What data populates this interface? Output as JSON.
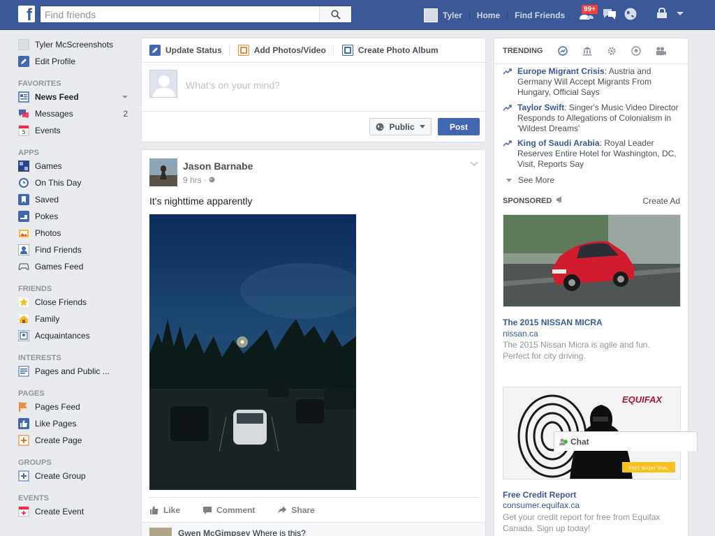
{
  "topbar": {
    "logo": "f",
    "search_placeholder": "Find friends",
    "user_name": "Tyler",
    "home": "Home",
    "find_friends": "Find Friends",
    "friend_requests_badge": "99+"
  },
  "leftnav": {
    "profile_name": "Tyler McScreenshots",
    "edit_profile": "Edit Profile",
    "favorites_head": "FAVORITES",
    "news_feed": "News Feed",
    "messages": "Messages",
    "messages_count": "2",
    "events": "Events",
    "apps_head": "APPS",
    "games": "Games",
    "on_this_day": "On This Day",
    "saved": "Saved",
    "pokes": "Pokes",
    "photos": "Photos",
    "find_friends": "Find Friends",
    "games_feed": "Games Feed",
    "friends_head": "FRIENDS",
    "close_friends": "Close Friends",
    "family": "Family",
    "acquaintances": "Acquaintances",
    "interests_head": "INTERESTS",
    "pages_public": "Pages and Public ...",
    "pages_head": "PAGES",
    "pages_feed": "Pages Feed",
    "like_pages": "Like Pages",
    "create_page": "Create Page",
    "groups_head": "GROUPS",
    "create_group": "Create Group",
    "events_head": "EVENTS",
    "create_event": "Create Event"
  },
  "composer": {
    "update_status": "Update Status",
    "add_photos": "Add Photos/Video",
    "create_album": "Create Photo Album",
    "placeholder": "What's on your mind?",
    "privacy": "Public",
    "post": "Post"
  },
  "post": {
    "author": "Jason Barnabe",
    "time": "9 hrs",
    "text": "It's nighttime apparently",
    "like": "Like",
    "comment": "Comment",
    "share": "Share",
    "comment_author": "Gwen McGimpsey",
    "comment_text": "Where is this?"
  },
  "trending": {
    "title": "TRENDING",
    "items": [
      {
        "topic": "Europe Migrant Crisis",
        "desc": ": Austria and Germany Will Accept Migrants From Hungary, Official Says"
      },
      {
        "topic": "Taylor Swift",
        "desc": ": Singer's Music Video Director Responds to Allegations of Colonialism in 'Wildest Dreams'"
      },
      {
        "topic": "King of Saudi Arabia",
        "desc": ": Royal Leader Reserves Entire Hotel for Washington, DC, Visit, Reports Say"
      }
    ],
    "see_more": "See More"
  },
  "sponsored": {
    "title": "SPONSORED",
    "create_ad": "Create Ad",
    "ads": [
      {
        "title": "The 2015 NISSAN MICRA",
        "url": "nissan.ca",
        "desc": "The 2015 Nissan Micra is agile and fun. Perfect for city driving."
      },
      {
        "title": "Free Credit Report",
        "url": "consumer.equifax.ca",
        "desc": "Get your credit report for free from Equifax Canada. Sign up today!",
        "brand": "EQUIFAX",
        "cta": "FREE 30-DAY TRIAL"
      }
    ]
  },
  "chat": {
    "label": "Chat"
  },
  "colors": {
    "brand": "#3b5998",
    "link": "#365899",
    "post_button": "#4267b2",
    "badge": "#fa3e3e"
  }
}
